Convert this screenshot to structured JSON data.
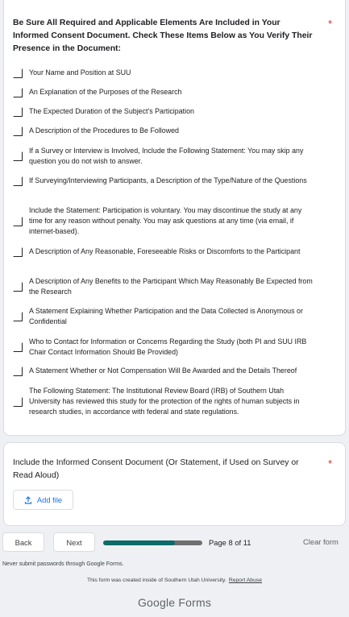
{
  "question1": {
    "title": "Be Sure All Required and Applicable Elements Are Included in Your Informed Consent Document. Check These Items Below as You Verify Their Presence in the Document:",
    "required_mark": "*",
    "options": [
      "Your Name and Position at SUU",
      "An Explanation of the Purposes of the Research",
      "The Expected Duration of the Subject's Participation",
      "A Description of the Procedures to Be Followed",
      "If a Survey or Interview is Involved, Include the Following Statement: You may skip any question you do not wish to answer.",
      "If Surveying/Interviewing Participants, a Description of the Type/Nature of the Questions",
      "Include the Statement: Participation is voluntary. You may discontinue the study at any time for any reason without penalty. You may ask questions at any time (via email, if internet-based).",
      "A Description of Any Reasonable, Foreseeable Risks or Discomforts to the Participant",
      "A Description of Any Benefits to the Participant Which May Reasonably Be Expected from the Research",
      "A Statement Explaining Whether Participation and the Data Collected is Anonymous or Confidential",
      "Who to Contact for Information or Concerns Regarding the Study (both PI and SUU IRB Chair Contact Information Should Be Provided)",
      "A Statement Whether or Not Compensation Will Be Awarded and the Details Thereof",
      "The Following Statement: The Institutional Review Board (IRB) of Southern Utah University has reviewed this study for the protection of the rights of human subjects in research studies, in accordance with federal and state regulations."
    ]
  },
  "question2": {
    "title": "Include the Informed Consent Document (Or Statement, if Used on Survey or Read Aloud)",
    "required_mark": "*",
    "add_file_label": "Add file",
    "icon": "upload-icon"
  },
  "navigation": {
    "back_label": "Back",
    "next_label": "Next",
    "page_text": "Page 8 of 11",
    "progress_fraction": 0.7273,
    "clear_label": "Clear form"
  },
  "footer": {
    "password_warning": "Never submit passwords through Google Forms.",
    "created_note": "This form was created inside of Southern Utah University.",
    "report_abuse": "Report Abuse",
    "brand": "Google Forms"
  },
  "colors": {
    "required": "#d93025",
    "accent": "#1a73e8",
    "progress_fill": "#0d6b69",
    "progress_track": "#6f6f6f",
    "background": "#eef0f3"
  }
}
